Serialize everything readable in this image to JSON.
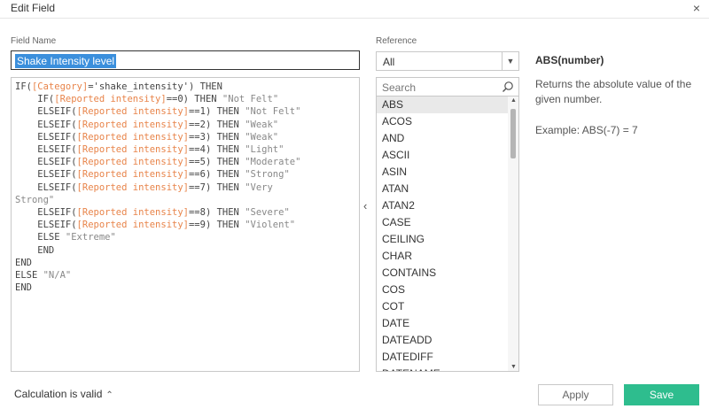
{
  "window": {
    "title": "Edit Field",
    "close_icon": "×"
  },
  "field": {
    "label": "Field Name",
    "value": "Shake Intensity level"
  },
  "reference": {
    "label": "Reference",
    "category_selected": "All",
    "search_placeholder": "Search",
    "functions": [
      "ABS",
      "ACOS",
      "AND",
      "ASCII",
      "ASIN",
      "ATAN",
      "ATAN2",
      "CASE",
      "CEILING",
      "CHAR",
      "CONTAINS",
      "COS",
      "COT",
      "DATE",
      "DATEADD",
      "DATEDIFF",
      "DATENAME"
    ],
    "selected_function": "ABS"
  },
  "description": {
    "title": "ABS(number)",
    "body": "Returns the absolute value of the given number.",
    "example": "Example: ABS(-7) = 7"
  },
  "formula": [
    [
      {
        "t": "IF(",
        "c": "k"
      },
      {
        "t": "[Category]",
        "c": "f"
      },
      {
        "t": "='shake_intensity') THEN",
        "c": "k"
      }
    ],
    [
      {
        "t": "    IF(",
        "c": "k"
      },
      {
        "t": "[Reported intensity]",
        "c": "f"
      },
      {
        "t": "==0) THEN ",
        "c": "k"
      },
      {
        "t": "\"Not Felt\"",
        "c": "s"
      }
    ],
    [
      {
        "t": "    ELSEIF(",
        "c": "k"
      },
      {
        "t": "[Reported intensity]",
        "c": "f"
      },
      {
        "t": "==1) THEN ",
        "c": "k"
      },
      {
        "t": "\"Not Felt\"",
        "c": "s"
      }
    ],
    [
      {
        "t": "    ELSEIF(",
        "c": "k"
      },
      {
        "t": "[Reported intensity]",
        "c": "f"
      },
      {
        "t": "==2) THEN ",
        "c": "k"
      },
      {
        "t": "\"Weak\"",
        "c": "s"
      }
    ],
    [
      {
        "t": "    ELSEIF(",
        "c": "k"
      },
      {
        "t": "[Reported intensity]",
        "c": "f"
      },
      {
        "t": "==3) THEN ",
        "c": "k"
      },
      {
        "t": "\"Weak\"",
        "c": "s"
      }
    ],
    [
      {
        "t": "    ELSEIF(",
        "c": "k"
      },
      {
        "t": "[Reported intensity]",
        "c": "f"
      },
      {
        "t": "==4) THEN ",
        "c": "k"
      },
      {
        "t": "\"Light\"",
        "c": "s"
      }
    ],
    [
      {
        "t": "    ELSEIF(",
        "c": "k"
      },
      {
        "t": "[Reported intensity]",
        "c": "f"
      },
      {
        "t": "==5) THEN ",
        "c": "k"
      },
      {
        "t": "\"Moderate\"",
        "c": "s"
      }
    ],
    [
      {
        "t": "    ELSEIF(",
        "c": "k"
      },
      {
        "t": "[Reported intensity]",
        "c": "f"
      },
      {
        "t": "==6) THEN ",
        "c": "k"
      },
      {
        "t": "\"Strong\"",
        "c": "s"
      }
    ],
    [
      {
        "t": "    ELSEIF(",
        "c": "k"
      },
      {
        "t": "[Reported intensity]",
        "c": "f"
      },
      {
        "t": "==7) THEN ",
        "c": "k"
      },
      {
        "t": "\"Very",
        "c": "s"
      }
    ],
    [
      {
        "t": "Strong\"",
        "c": "s"
      }
    ],
    [
      {
        "t": "    ELSEIF(",
        "c": "k"
      },
      {
        "t": "[Reported intensity]",
        "c": "f"
      },
      {
        "t": "==8) THEN ",
        "c": "k"
      },
      {
        "t": "\"Severe\"",
        "c": "s"
      }
    ],
    [
      {
        "t": "    ELSEIF(",
        "c": "k"
      },
      {
        "t": "[Reported intensity]",
        "c": "f"
      },
      {
        "t": "==9) THEN ",
        "c": "k"
      },
      {
        "t": "\"Violent\"",
        "c": "s"
      }
    ],
    [
      {
        "t": "    ELSE ",
        "c": "k"
      },
      {
        "t": "\"Extreme\"",
        "c": "s"
      }
    ],
    [
      {
        "t": "    END",
        "c": "k"
      }
    ],
    [
      {
        "t": "END",
        "c": "k"
      }
    ],
    [
      {
        "t": "ELSE ",
        "c": "k"
      },
      {
        "t": "\"N/A\"",
        "c": "s"
      }
    ],
    [
      {
        "t": "END",
        "c": "k"
      }
    ]
  ],
  "footer": {
    "status": "Calculation is valid",
    "apply_label": "Apply",
    "save_label": "Save"
  },
  "colors": {
    "accent": "#2ebd8e",
    "field_ref": "#e8844a",
    "selection": "#3b8fdc"
  }
}
